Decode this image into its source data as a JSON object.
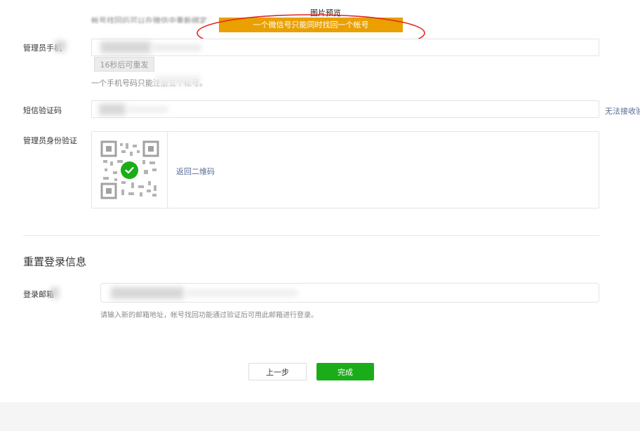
{
  "overlay": {
    "preview_title": "图片预览",
    "banner_text": "一个微信号只能同时找回一个帐号",
    "faded_text": "帐号找回后可以在微信中重新绑定"
  },
  "form": {
    "phone": {
      "label": "管理员手机",
      "resend_label": "16秒后可重发",
      "tip": "一个手机号码只能注册五个帐号。"
    },
    "sms": {
      "label": "短信验证码",
      "side_link": "无法接收验证码"
    },
    "identity": {
      "label": "管理员身份验证",
      "back_link": "返回二维码"
    }
  },
  "reset_section": {
    "title": "重置登录信息",
    "email_label": "登录邮箱",
    "email_hint": "请输入新的邮箱地址，帐号找回功能通过验证后可用此邮箱进行登录。"
  },
  "actions": {
    "prev_label": "上一步",
    "done_label": "完成"
  },
  "colors": {
    "primary_green": "#1aad19",
    "banner_orange": "#e9a000",
    "link_blue": "#576b95",
    "annotation_red": "#e0261f"
  }
}
